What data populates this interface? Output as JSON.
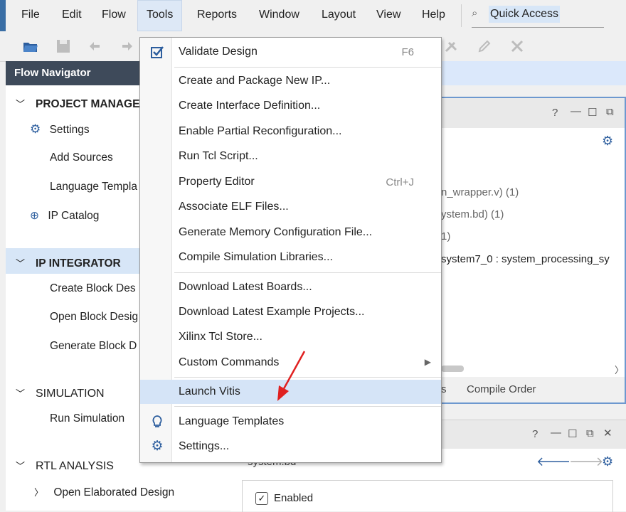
{
  "menubar": {
    "items": [
      "File",
      "Edit",
      "Flow",
      "Tools",
      "Reports",
      "Window",
      "Layout",
      "View",
      "Help"
    ],
    "quick_access": "Quick Access"
  },
  "flow_navigator": {
    "title": "Flow Navigator",
    "project_manager": {
      "label": "PROJECT MANAGER",
      "items": [
        "Settings",
        "Add Sources",
        "Language Templa",
        "IP Catalog"
      ]
    },
    "ip_integrator": {
      "label": "IP INTEGRATOR",
      "items": [
        "Create Block Des",
        "Open Block Desig",
        "Generate Block D"
      ]
    },
    "simulation": {
      "label": "SIMULATION",
      "items": [
        "Run Simulation"
      ]
    },
    "rtl_analysis": {
      "label": "RTL ANALYSIS",
      "items": [
        "Open Elaborated Design"
      ]
    }
  },
  "sources_panel": {
    "lines": [
      "n_wrapper.v) (1)",
      "ystem.bd) (1)",
      "1)",
      "system7_0 : system_processing_sy"
    ],
    "tabs": [
      "s",
      "Compile Order"
    ]
  },
  "properties_panel": {
    "file": "system.bd",
    "enabled_label": "Enabled"
  },
  "tools_menu": {
    "validate": {
      "label": "Validate Design",
      "shortcut": "F6"
    },
    "group1": [
      "Create and Package New IP...",
      "Create Interface Definition...",
      "Enable Partial Reconfiguration...",
      "Run Tcl Script..."
    ],
    "property_editor": {
      "label": "Property Editor",
      "shortcut": "Ctrl+J"
    },
    "group1b": [
      "Associate ELF Files...",
      "Generate Memory Configuration File...",
      "Compile Simulation Libraries..."
    ],
    "group2": [
      "Download Latest Boards...",
      "Download Latest Example Projects...",
      "Xilinx Tcl Store..."
    ],
    "custom_commands": "Custom Commands",
    "launch_vitis": "Launch Vitis",
    "language_templates": "Language Templates",
    "settings": "Settings..."
  },
  "colors": {
    "accent": "#3a6ea5",
    "navigator_header": "#3e4a5a",
    "selection": "#d5e4f7",
    "annotation_arrow": "#e02020"
  }
}
